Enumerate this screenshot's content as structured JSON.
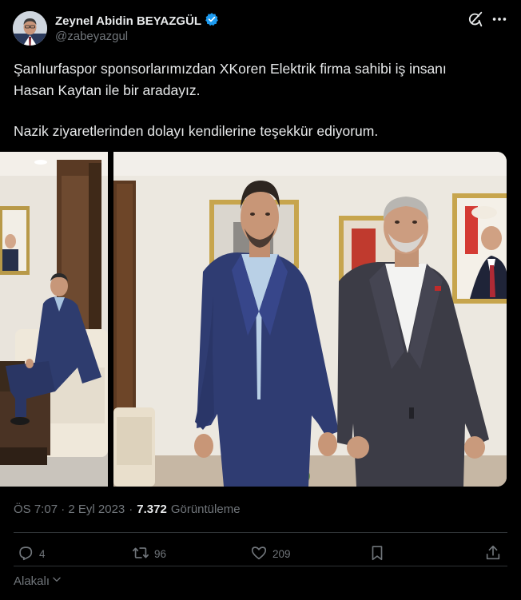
{
  "author": {
    "display_name": "Zeynel Abidin BEYAZGÜL",
    "handle": "@zabeyazgul"
  },
  "tweet": {
    "line1": "Şanlıurfaspor sponsorlarımızdan XKoren Elektrik firma sahibi iş insanı",
    "line2": "Hasan Kaytan ile bir aradayız.",
    "line3": "Nazik ziyaretlerinden dolayı kendilerine teşekkür ediyorum."
  },
  "meta": {
    "time": "ÖS 7:07",
    "separator": "·",
    "date": "2 Eyl 2023",
    "views_count": "7.372",
    "views_label": "Görüntüleme"
  },
  "actions": {
    "replies": "4",
    "reposts": "96",
    "likes": "209"
  },
  "relevant": {
    "label": "Alakalı"
  },
  "icons": [
    "avatar",
    "verified-badge-icon",
    "grok-icon",
    "more-icon",
    "reply-icon",
    "repost-icon",
    "like-icon",
    "bookmark-icon",
    "share-icon",
    "chevron-down-icon"
  ],
  "colors": {
    "background": "#000000",
    "text": "#e7e9ea",
    "muted": "#71767b",
    "verified": "#1d9bf0",
    "divider": "#2f3336"
  }
}
